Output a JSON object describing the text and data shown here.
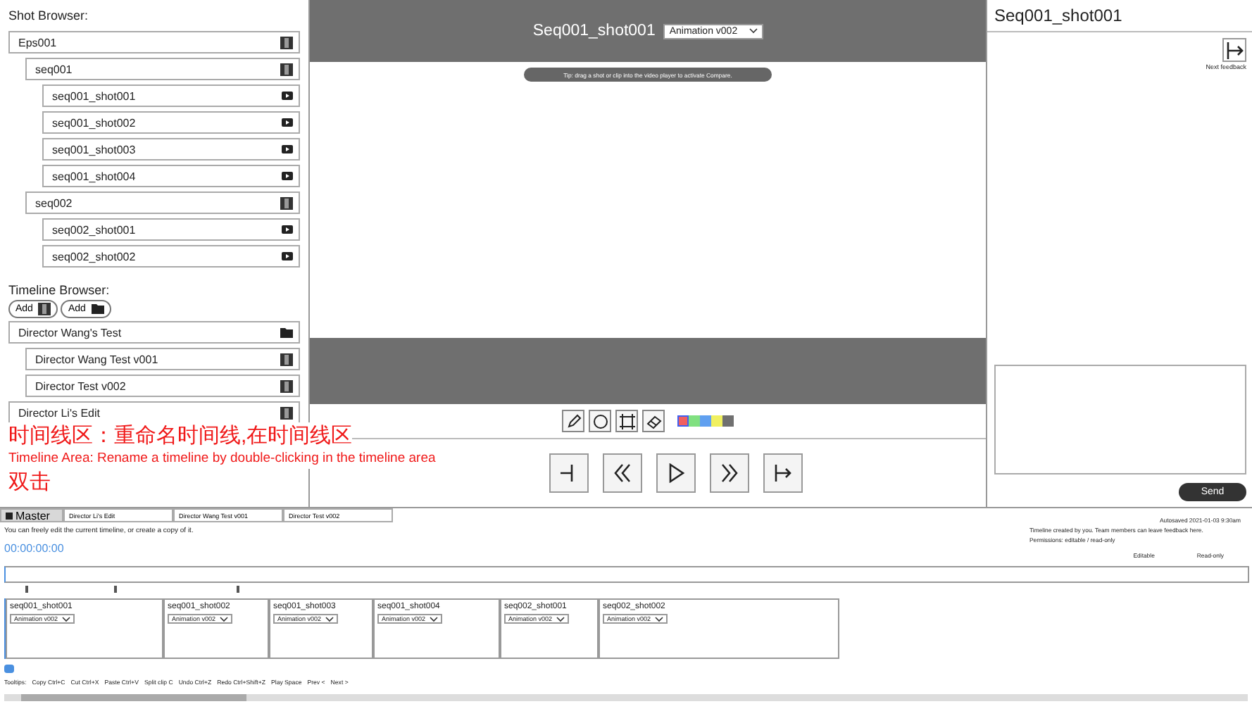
{
  "shot_browser": {
    "title": "Shot Browser:",
    "items": [
      {
        "label": "Eps001",
        "kind": "group",
        "children": [
          {
            "label": "seq001",
            "kind": "group",
            "children": [
              {
                "label": "seq001_shot001",
                "kind": "shot"
              },
              {
                "label": "seq001_shot002",
                "kind": "shot"
              },
              {
                "label": "seq001_shot003",
                "kind": "shot"
              },
              {
                "label": "seq001_shot004",
                "kind": "shot"
              }
            ]
          },
          {
            "label": "seq002",
            "kind": "group",
            "children": [
              {
                "label": "seq002_shot001",
                "kind": "shot"
              },
              {
                "label": "seq002_shot002",
                "kind": "shot"
              }
            ]
          }
        ]
      }
    ]
  },
  "timeline_browser": {
    "title": "Timeline Browser:",
    "add_buttons": [
      {
        "label": "Add",
        "kind": "timeline"
      },
      {
        "label": "Add",
        "kind": "folder"
      }
    ],
    "items": [
      {
        "label": "Director Wang's Test",
        "kind": "folder",
        "children": [
          {
            "label": "Director Wang Test v001",
            "kind": "timeline"
          },
          {
            "label": "Director Test v002",
            "kind": "timeline"
          }
        ]
      },
      {
        "label": "Director Li's Edit",
        "kind": "timeline"
      }
    ]
  },
  "annotation": [
    "时间线区：重命名时间线,在时间线区",
    "Timeline Area: Rename a timeline by double-clicking in the timeline area",
    "双击"
  ],
  "player": {
    "title": "Seq001_shot001",
    "version": "Animation v002",
    "tip": "Tip: drag a shot or clip into the video player to activate Compare.",
    "colors": [
      {
        "color": "#f06060",
        "selected": true
      },
      {
        "color": "#80e080",
        "selected": false
      },
      {
        "color": "#60a0f0",
        "selected": false
      },
      {
        "color": "#f0f060",
        "selected": false
      },
      {
        "color": "#707070",
        "selected": false
      }
    ]
  },
  "feedback": {
    "title": "Seq001_shot001",
    "next_label": "Next feedback",
    "send": "Send"
  },
  "timeline": {
    "tabs": [
      {
        "label": "Master",
        "selected": true
      },
      {
        "label": "Director Li's Edit",
        "selected": false
      },
      {
        "label": "Director Wang Test v001",
        "selected": false
      },
      {
        "label": "Director Test v002",
        "selected": false
      }
    ],
    "hint": "You can freely edit the current timeline, or create a copy of it.",
    "timecode": "00:00:00:00",
    "saved": "Autosaved 2021-01-03 9:30am",
    "info": [
      "Timeline created by you. Team members can leave feedback here.",
      "Permissions: editable / read-only"
    ],
    "permissions": [
      "Editable",
      "Read-only"
    ],
    "clips": [
      {
        "name": "seq001_shot001",
        "version": "Animation v002"
      },
      {
        "name": "seq001_shot002",
        "version": "Animation v002"
      },
      {
        "name": "seq001_shot003",
        "version": "Animation v002"
      },
      {
        "name": "seq001_shot004",
        "version": "Animation v002"
      },
      {
        "name": "seq002_shot001",
        "version": "Animation v002"
      },
      {
        "name": "seq002_shot002",
        "version": "Animation v002"
      }
    ],
    "tooltips": [
      "Tooltips:",
      "Copy Ctrl+C",
      "Cut Ctrl+X",
      "Paste Ctrl+V",
      "Split clip C",
      "Undo Ctrl+Z",
      "Redo Ctrl+Shift+Z",
      "Play Space",
      "Prev <",
      "Next >"
    ]
  }
}
